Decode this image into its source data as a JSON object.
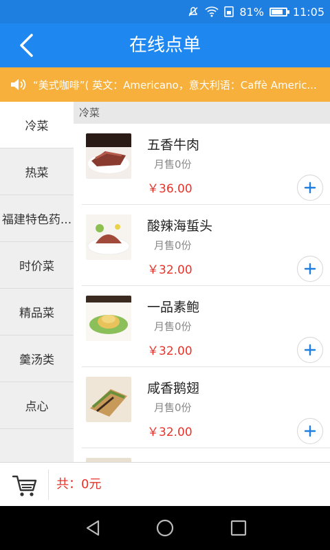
{
  "status_bar": {
    "battery": "81%",
    "time": "11:05",
    "battery_level": 0.81
  },
  "header": {
    "title": "在线点单"
  },
  "notice": {
    "text": "“美式咖啡”( 英文：Americano，意大利语：Caffè Americ..."
  },
  "sidebar": {
    "items": [
      {
        "label": "冷菜"
      },
      {
        "label": "热菜"
      },
      {
        "label": "福建特色药..."
      },
      {
        "label": "时价菜"
      },
      {
        "label": "精品菜"
      },
      {
        "label": "羹汤类"
      },
      {
        "label": "点心"
      }
    ]
  },
  "content": {
    "section_title": "冷菜",
    "items": [
      {
        "name": "五香牛肉",
        "sold": "月售0份",
        "price": "￥36.00"
      },
      {
        "name": "酸辣海蜇头",
        "sold": "月售0份",
        "price": "￥32.00"
      },
      {
        "name": "一品素鲍",
        "sold": "月售0份",
        "price": "￥32.00"
      },
      {
        "name": "咸香鹅翅",
        "sold": "月售0份",
        "price": "￥32.00"
      },
      {
        "name": "",
        "sold": "",
        "price": ""
      }
    ]
  },
  "cart": {
    "total": "共：0元"
  },
  "colors": {
    "primary": "#1e88f0",
    "notice": "#f6b03b",
    "price": "#e8332a"
  }
}
